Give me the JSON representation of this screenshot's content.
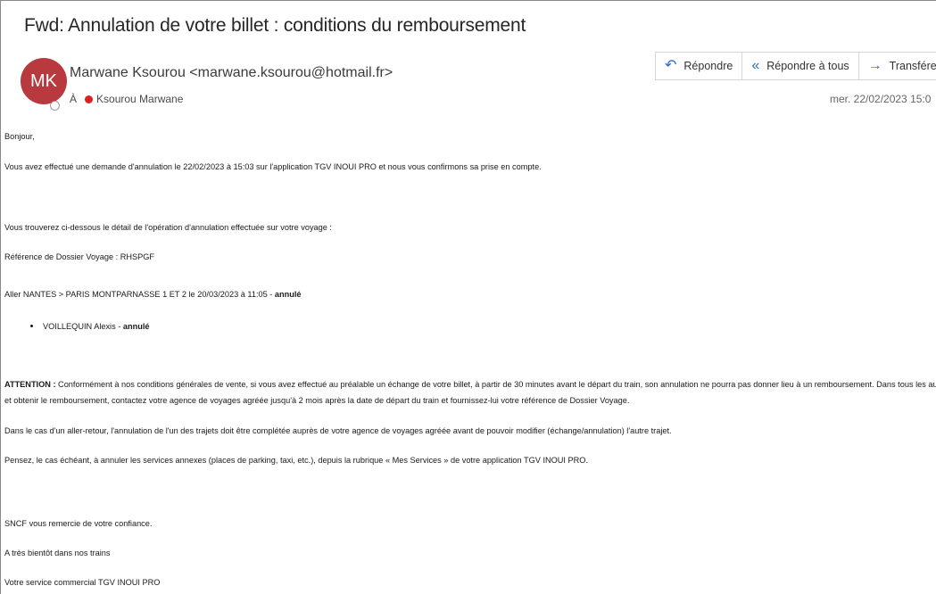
{
  "email": {
    "subject": "Fwd: Annulation de votre billet : conditions du remboursement",
    "avatar_initials": "MK",
    "sender": "Marwane Ksourou <marwane.ksourou@hotmail.fr>",
    "to_label": "À",
    "recipient": "Ksourou Marwane",
    "date": "mer. 22/02/2023 15:0"
  },
  "actions": {
    "reply": "Répondre",
    "reply_all": "Répondre à tous",
    "forward": "Transférer",
    "more": "···"
  },
  "icons": {
    "reply": "reply-icon",
    "reply_all": "reply-all-icon",
    "forward": "forward-arrow-icon",
    "more": "more-options-icon",
    "recipient_status": "red-status-dot-icon"
  },
  "colors": {
    "avatar_bg": "#b83a3e",
    "icon_accent": "#2b6cc4",
    "recipient_dot": "#e02020"
  },
  "body": {
    "greeting": "Bonjour,",
    "p1": "Vous avez effectué une demande d'annulation le 22/02/2023 à 15:03 sur l'application TGV INOUI PRO et nous vous confirmons sa prise en compte.",
    "p2": "Vous trouverez ci-dessous le détail de l'opération d'annulation effectuée sur votre voyage :",
    "p3": "Référence de Dossier Voyage : RHSPGF",
    "p4_text": "Aller NANTES > PARIS MONTPARNASSE 1 ET 2 le 20/03/2023 à 11:05 - ",
    "p4_bold": "annulé",
    "bullet_text": "VOILLEQUIN Alexis - ",
    "bullet_bold": "annulé",
    "attention_label": "ATTENTION :",
    "attention_line1": " Conformément à nos conditions générales de vente, si vous avez effectué au préalable un échange de votre billet, à partir de 30 minutes avant le départ du train, son annulation ne pourra pas donner lieu à un remboursement. Dans tous les autres cas, pour finaliser votre annulation",
    "attention_line2": "et obtenir le remboursement, contactez votre agence de voyages agréée jusqu'à 2 mois après la date de départ du train et fournissez-lui votre référence de Dossier Voyage.",
    "p5": "Dans le cas d'un aller-retour, l'annulation de l'un des trajets doit être complétée auprès de votre agence de voyages agréée avant de pouvoir modifier (échange/annulation) l'autre trajet.",
    "p6": "Pensez, le cas échéant, à annuler les services annexes (places de parking, taxi, etc.), depuis la rubrique « Mes Services » de votre application TGV INOUI PRO.",
    "p7": "SNCF vous remercie de votre confiance.",
    "p8": "A très bientôt dans nos trains",
    "p9": "Votre service commercial TGV INOUI PRO"
  }
}
